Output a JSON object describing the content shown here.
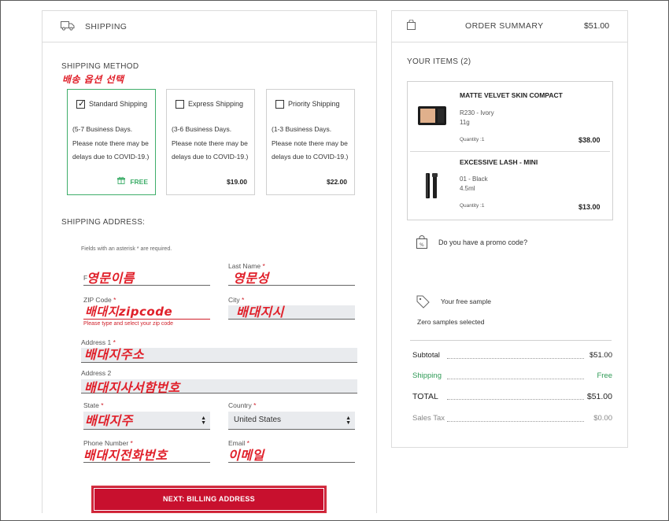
{
  "shipping": {
    "header_title": "SHIPPING",
    "method_title": "SHIPPING METHOD",
    "method_annotation": "배송 옵션 선택",
    "options": [
      {
        "name": "Standard Shipping",
        "description": "(5-7 Business Days. Please note there may be delays due to COVID-19.)",
        "price": "FREE",
        "selected": true
      },
      {
        "name": "Express Shipping",
        "description": "(3-6 Business Days. Please note there may be delays due to COVID-19.)",
        "price": "$19.00",
        "selected": false
      },
      {
        "name": "Priority Shipping",
        "description": "(1-3 Business Days. Please note there may be delays due to COVID-19.)",
        "price": "$22.00",
        "selected": false
      }
    ],
    "address_title": "SHIPPING ADDRESS:",
    "required_note": "Fields with an asterisk * are required.",
    "fields": {
      "first_name": {
        "label": "F",
        "annotation": "영문이름"
      },
      "last_name": {
        "label": "Last Name",
        "annotation": "영문성"
      },
      "zip": {
        "label": "ZIP Code",
        "annotation": "배대지zipcode",
        "error": "Please type and select your zip code"
      },
      "city": {
        "label": "City",
        "annotation": "배대지시"
      },
      "address1": {
        "label": "Address 1",
        "annotation": "배대지주소"
      },
      "address2": {
        "label": "Address 2",
        "annotation": "배대지사서함번호"
      },
      "state": {
        "label": "State",
        "annotation": "배대지주"
      },
      "country": {
        "label": "Country",
        "value": "United States"
      },
      "phone": {
        "label": "Phone Number",
        "annotation": "배대지전화번호"
      },
      "email": {
        "label": "Email",
        "annotation": "이메일"
      }
    },
    "required_marker": "*",
    "next_button": "NEXT: BILLING ADDRESS"
  },
  "order_summary": {
    "title": "ORDER SUMMARY",
    "header_total": "$51.00",
    "items_title": "YOUR ITEMS (2)",
    "items": [
      {
        "name": "MATTE VELVET SKIN COMPACT",
        "shade": "R230 - Ivory",
        "size": "11g",
        "quantity": "Quantity :1",
        "price": "$38.00"
      },
      {
        "name": "EXCESSIVE LASH - MINI",
        "shade": "01 - Black",
        "size": "4.5ml",
        "quantity": "Quantity :1",
        "price": "$13.00"
      }
    ],
    "promo_label": "Do you have a promo code?",
    "sample_title": "Your free sample",
    "sample_status": "Zero samples selected",
    "totals": {
      "subtotal_label": "Subtotal",
      "subtotal_value": "$51.00",
      "shipping_label": "Shipping",
      "shipping_value": "Free",
      "total_label": "TOTAL",
      "total_value": "$51.00",
      "tax_label": "Sales Tax",
      "tax_value": "$0.00"
    }
  },
  "colors": {
    "accent_red": "#c8102e",
    "success_green": "#3fae6a",
    "field_fill": "#e9ebee",
    "annotation_red": "#e0202a"
  },
  "icons": [
    "truck-icon",
    "shopping-bag-icon",
    "checkbox-icon",
    "gift-icon",
    "promo-tag-bag-icon",
    "sample-tag-icon",
    "select-caret-icon"
  ]
}
